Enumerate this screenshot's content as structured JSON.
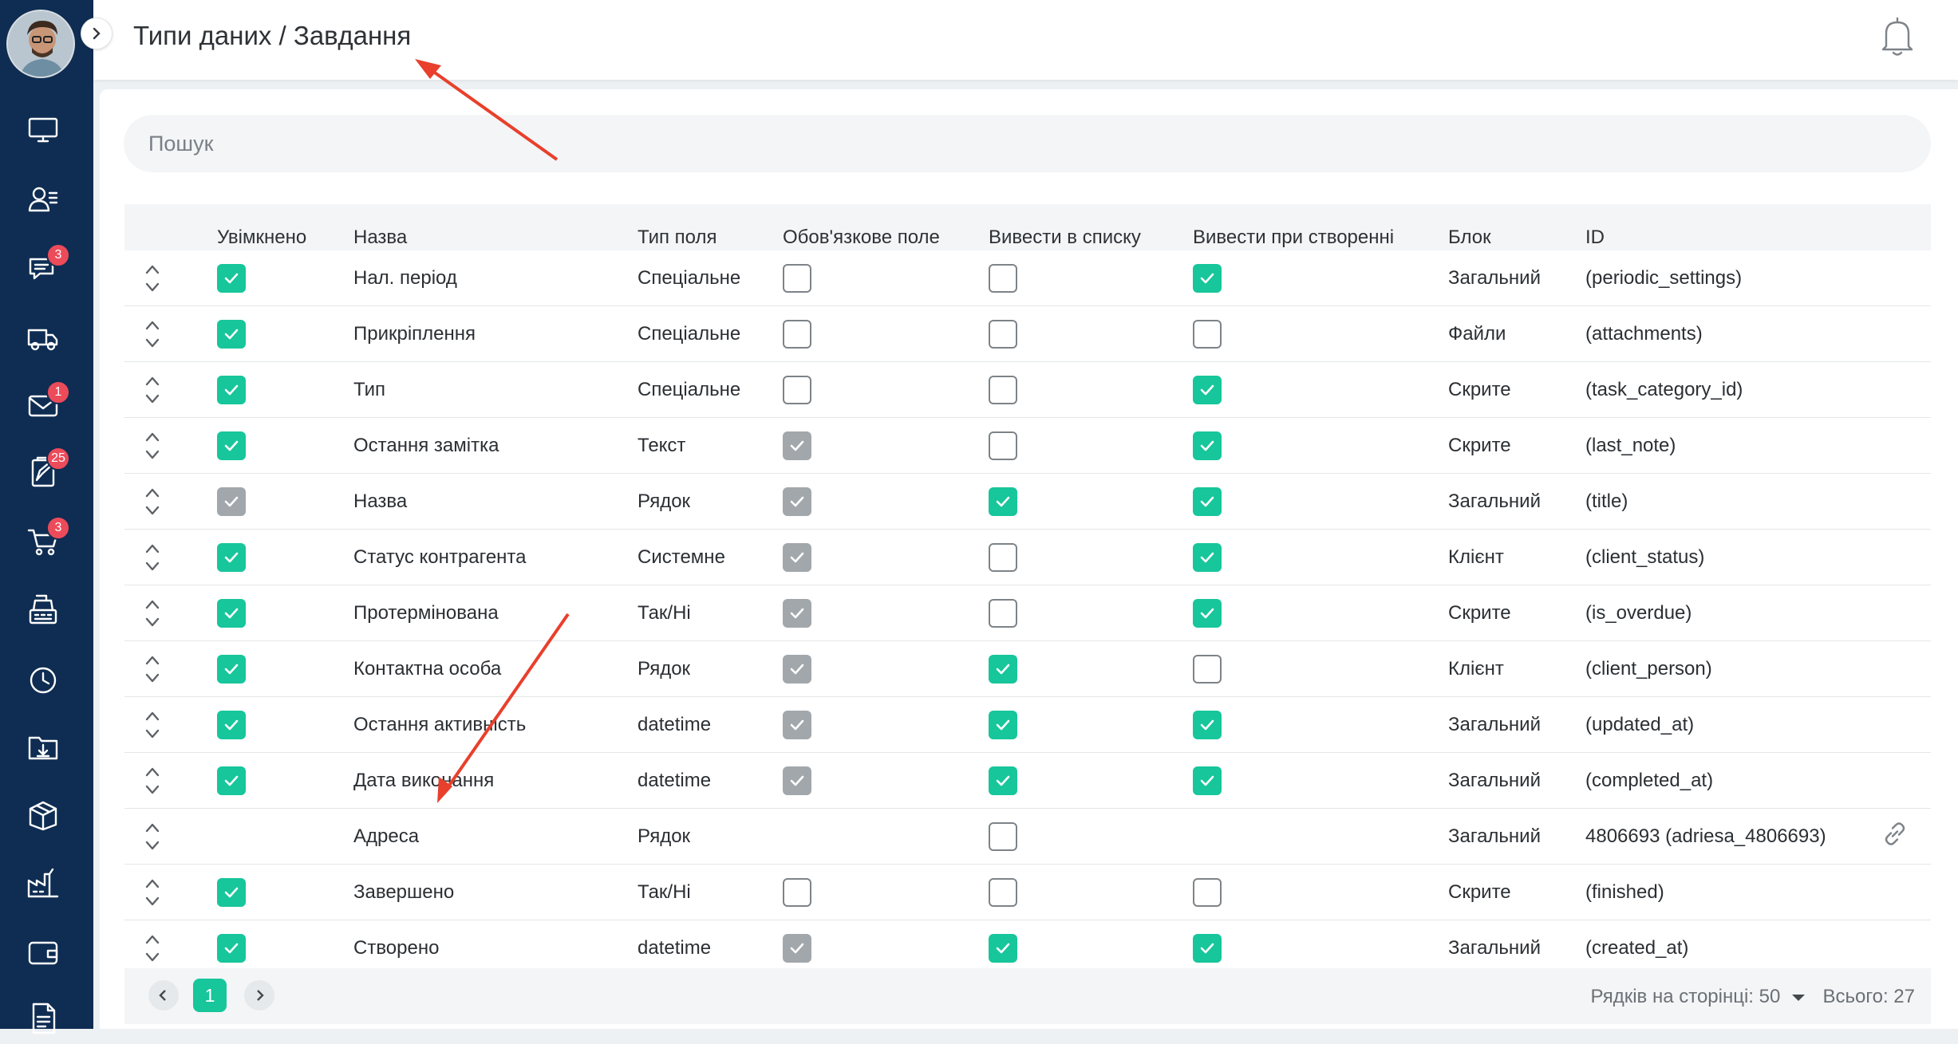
{
  "header": {
    "breadcrumb": "Типи даних / Завдання"
  },
  "search": {
    "placeholder": "Пошук"
  },
  "sidebar": {
    "items": [
      {
        "icon": "monitor-icon",
        "badge": null
      },
      {
        "icon": "contacts-icon",
        "badge": null
      },
      {
        "icon": "chat-icon",
        "badge": "3"
      },
      {
        "icon": "truck-icon",
        "badge": null
      },
      {
        "icon": "mail-icon",
        "badge": "1"
      },
      {
        "icon": "tasks-icon",
        "badge": "25"
      },
      {
        "icon": "cart-icon",
        "badge": "3"
      },
      {
        "icon": "cash-register-icon",
        "badge": null
      },
      {
        "icon": "clock-icon",
        "badge": null
      },
      {
        "icon": "folder-download-icon",
        "badge": null
      },
      {
        "icon": "box-icon",
        "badge": null
      },
      {
        "icon": "factory-icon",
        "badge": null
      },
      {
        "icon": "wallet-icon",
        "badge": null
      },
      {
        "icon": "document-icon",
        "badge": null
      }
    ]
  },
  "table": {
    "columns": {
      "enabled": "Увімкнено",
      "name": "Назва",
      "type": "Тип поля",
      "required": "Обов'язкове поле",
      "in_list": "Вивести в списку",
      "on_create": "Вивести при створенні",
      "block": "Блок",
      "id": "ID"
    },
    "rows": [
      {
        "enabled": "on",
        "name": "Нал. період",
        "type": "Спеціальне",
        "required": "off",
        "in_list": "off",
        "on_create": "on",
        "block": "Загальний",
        "id": "(periodic_settings)",
        "link": false
      },
      {
        "enabled": "on",
        "name": "Прикріплення",
        "type": "Спеціальне",
        "required": "off",
        "in_list": "off",
        "on_create": "off",
        "block": "Файли",
        "id": "(attachments)",
        "link": false
      },
      {
        "enabled": "on",
        "name": "Тип",
        "type": "Спеціальне",
        "required": "off",
        "in_list": "off",
        "on_create": "on",
        "block": "Скрите",
        "id": "(task_category_id)",
        "link": false
      },
      {
        "enabled": "on",
        "name": "Остання замітка",
        "type": "Текст",
        "required": "grey",
        "in_list": "off",
        "on_create": "on",
        "block": "Скрите",
        "id": "(last_note)",
        "link": false
      },
      {
        "enabled": "grey",
        "name": "Назва",
        "type": "Рядок",
        "required": "grey",
        "in_list": "on",
        "on_create": "on",
        "block": "Загальний",
        "id": "(title)",
        "link": false
      },
      {
        "enabled": "on",
        "name": "Статус контрагента",
        "type": "Системне",
        "required": "grey",
        "in_list": "off",
        "on_create": "on",
        "block": "Клієнт",
        "id": "(client_status)",
        "link": false
      },
      {
        "enabled": "on",
        "name": "Протермінована",
        "type": "Так/Ні",
        "required": "grey",
        "in_list": "off",
        "on_create": "on",
        "block": "Скрите",
        "id": "(is_overdue)",
        "link": false
      },
      {
        "enabled": "on",
        "name": "Контактна особа",
        "type": "Рядок",
        "required": "grey",
        "in_list": "on",
        "on_create": "off",
        "block": "Клієнт",
        "id": "(client_person)",
        "link": false
      },
      {
        "enabled": "on",
        "name": "Остання активність",
        "type": "datetime",
        "required": "grey",
        "in_list": "on",
        "on_create": "on",
        "block": "Загальний",
        "id": "(updated_at)",
        "link": false
      },
      {
        "enabled": "on",
        "name": "Дата виконання",
        "type": "datetime",
        "required": "grey",
        "in_list": "on",
        "on_create": "on",
        "block": "Загальний",
        "id": "(completed_at)",
        "link": false
      },
      {
        "enabled": "none",
        "name": "Адреса",
        "type": "Рядок",
        "required": "none",
        "in_list": "off",
        "on_create": "none",
        "block": "Загальний",
        "id": "4806693 (adriesa_4806693)",
        "link": true
      },
      {
        "enabled": "on",
        "name": "Завершено",
        "type": "Так/Ні",
        "required": "off",
        "in_list": "off",
        "on_create": "off",
        "block": "Скрите",
        "id": "(finished)",
        "link": false
      },
      {
        "enabled": "on",
        "name": "Створено",
        "type": "datetime",
        "required": "grey",
        "in_list": "on",
        "on_create": "on",
        "block": "Загальний",
        "id": "(created_at)",
        "link": false
      }
    ]
  },
  "pagination": {
    "current_page": "1",
    "rows_per_page_label": "Рядків на сторінці: 50",
    "total_label": "Всього: 27"
  },
  "colors": {
    "sidebar": "#0f2d52",
    "accent": "#17c69a",
    "annotation_arrow": "#e8402c"
  }
}
